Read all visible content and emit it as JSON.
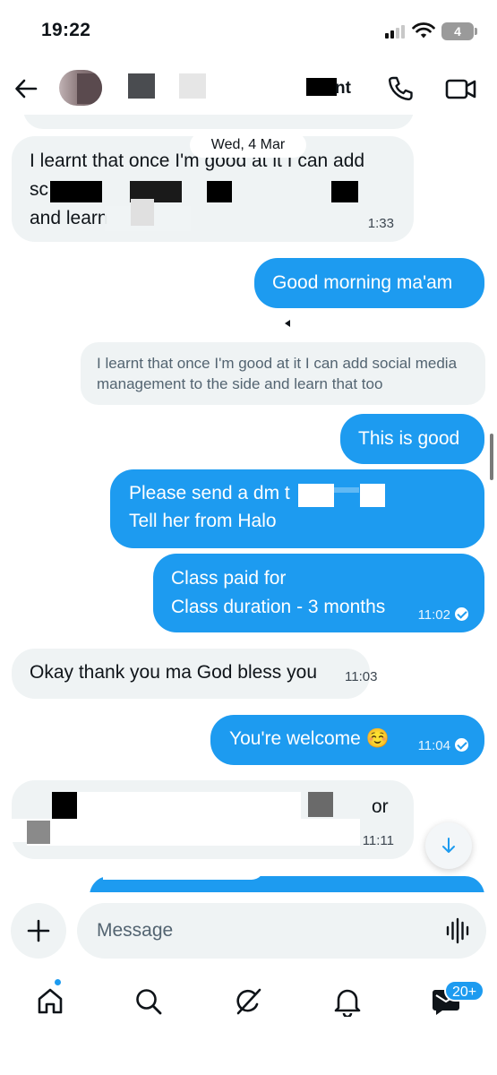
{
  "status_bar": {
    "time": "19:22",
    "battery_level": "4"
  },
  "header": {
    "contact_name_visible": "nt",
    "icons": [
      "back-arrow-icon",
      "phone-icon",
      "video-camera-icon"
    ]
  },
  "conversation": {
    "date_separator": "Wed, 4 Mar",
    "messages": [
      {
        "direction": "incoming",
        "line1": "I learnt that once I'm good at it I can add",
        "line2": "sc",
        "line3": "and learn",
        "time": "1:33"
      },
      {
        "direction": "outgoing",
        "text": "Good morning ma'am"
      },
      {
        "direction": "outgoing",
        "quoted_reply": "I learnt that once I'm good at it I can add social media management to the side and learn that too"
      },
      {
        "direction": "outgoing",
        "text": "This is good"
      },
      {
        "direction": "outgoing",
        "line1": "Please send a dm t",
        "line2": "Tell her from Halo"
      },
      {
        "direction": "outgoing",
        "line1": "Class paid for",
        "line2": "Class duration - 3 months",
        "time": "11:02",
        "status": "read"
      },
      {
        "direction": "incoming",
        "text": "Okay thank you ma God bless you",
        "time": "11:03"
      },
      {
        "direction": "outgoing",
        "text": "You're welcome ☺️",
        "time": "11:04",
        "status": "read"
      },
      {
        "direction": "incoming",
        "text_fragment": "or",
        "time": "11:11"
      }
    ],
    "scroll_down_icon": "arrow-down-icon"
  },
  "composer": {
    "placeholder": "Message",
    "icons": [
      "plus-icon",
      "voice-waveform-icon"
    ]
  },
  "bottom_nav": {
    "items": [
      "home-icon",
      "search-icon",
      "grok-icon",
      "notifications-bell-icon",
      "messages-icon"
    ],
    "messages_badge": "20+"
  },
  "colors": {
    "accent": "#1d9bf0",
    "incoming_bubble": "#eff3f4",
    "text": "#0f1419",
    "secondary_text": "#536471"
  }
}
